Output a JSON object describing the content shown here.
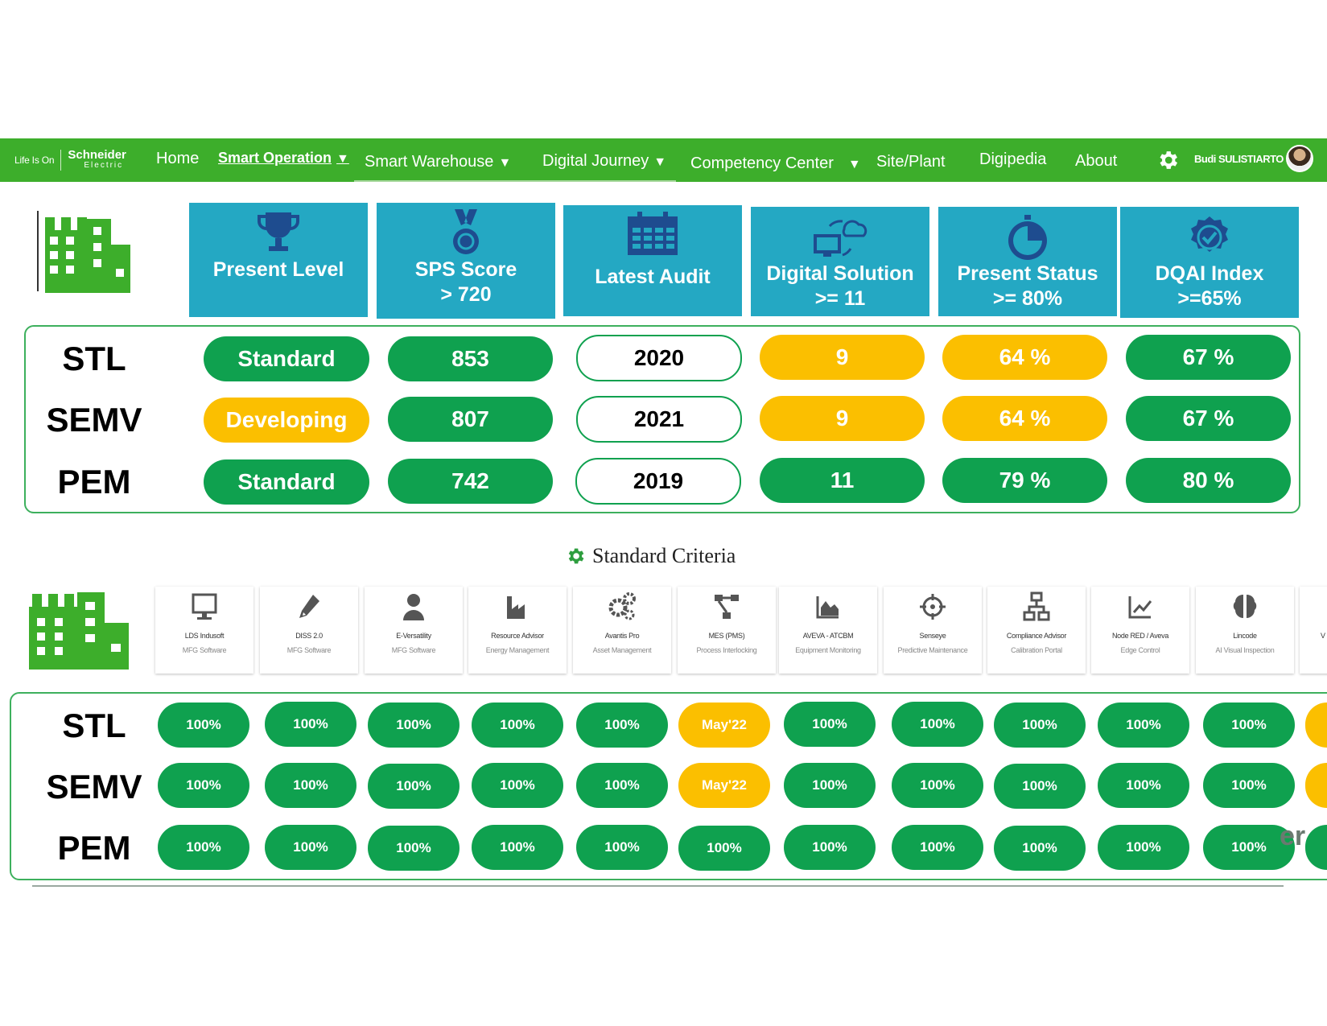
{
  "nav": {
    "tagline": "Life Is On",
    "logo_main": "Schneider",
    "logo_sub": "Electric",
    "items": [
      {
        "label": "Home",
        "active": false,
        "caret": false
      },
      {
        "label": "Smart Operation",
        "active": true,
        "caret": true
      },
      {
        "label": "Smart Warehouse",
        "active": false,
        "caret": true
      },
      {
        "label": "Digital Journey",
        "active": false,
        "caret": true
      },
      {
        "label": "Competency Center",
        "active": false,
        "caret": true
      },
      {
        "label": "Site/Plant",
        "active": false,
        "caret": false
      },
      {
        "label": "Digipedia",
        "active": false,
        "caret": false
      },
      {
        "label": "About",
        "active": false,
        "caret": false
      }
    ],
    "caret_glyph": "▼",
    "settings_icon": "gear-icon",
    "user_name": "Budi SULISTIARTO"
  },
  "colors": {
    "nav_green": "#3dae2b",
    "card_teal": "#24a8c3",
    "icon_navy": "#1e4c8f",
    "status_green": "#0fa14f",
    "status_yellow": "#fbbf00",
    "building_green": "#3dae2b"
  },
  "summary": {
    "headers": [
      {
        "icon": "trophy-icon",
        "line1": "Present Level",
        "line2": ""
      },
      {
        "icon": "medal-icon",
        "line1": "SPS Score",
        "line2": "> 720"
      },
      {
        "icon": "calendar-icon",
        "line1": "Latest Audit",
        "line2": ""
      },
      {
        "icon": "cloud-sync-icon",
        "line1": "Digital Solution",
        "line2": ">= 11"
      },
      {
        "icon": "stopwatch-icon",
        "line1": "Present Status",
        "line2": ">= 80%"
      },
      {
        "icon": "verified-badge-icon",
        "line1": "DQAI Index",
        "line2": ">=65%"
      }
    ],
    "rows": [
      {
        "plant": "STL",
        "cells": [
          {
            "value": "Standard",
            "status": "green"
          },
          {
            "value": "853",
            "status": "green"
          },
          {
            "value": "2020",
            "status": "white"
          },
          {
            "value": "9",
            "status": "yellow"
          },
          {
            "value": "64 %",
            "status": "yellow"
          },
          {
            "value": "67 %",
            "status": "green"
          }
        ]
      },
      {
        "plant": "SEMV",
        "cells": [
          {
            "value": "Developing",
            "status": "yellow"
          },
          {
            "value": "807",
            "status": "green"
          },
          {
            "value": "2021",
            "status": "white"
          },
          {
            "value": "9",
            "status": "yellow"
          },
          {
            "value": "64 %",
            "status": "yellow"
          },
          {
            "value": "67 %",
            "status": "green"
          }
        ]
      },
      {
        "plant": "PEM",
        "cells": [
          {
            "value": "Standard",
            "status": "green"
          },
          {
            "value": "742",
            "status": "green"
          },
          {
            "value": "2019",
            "status": "white"
          },
          {
            "value": "11",
            "status": "green"
          },
          {
            "value": "79 %",
            "status": "green"
          },
          {
            "value": "80 %",
            "status": "green"
          }
        ]
      }
    ]
  },
  "criteria": {
    "title": "Standard Criteria",
    "tiles": [
      {
        "icon": "monitor-icon",
        "name": "LDS Indusoft",
        "sub": "MFG Software"
      },
      {
        "icon": "pen-icon",
        "name": "DISS 2.0",
        "sub": "MFG Software"
      },
      {
        "icon": "user-icon",
        "name": "E-Versatility",
        "sub": "MFG Software"
      },
      {
        "icon": "factory-icon",
        "name": "Resource Advisor",
        "sub": "Energy Management"
      },
      {
        "icon": "gears-icon",
        "name": "Avantis Pro",
        "sub": "Asset Management"
      },
      {
        "icon": "network-icon",
        "name": "MES (PMS)",
        "sub": "Process Interlocking"
      },
      {
        "icon": "area-chart-icon",
        "name": "AVEVA - ATCBM",
        "sub": "Equipment Monitoring"
      },
      {
        "icon": "crosshair-icon",
        "name": "Senseye",
        "sub": "Predictive Maintenance"
      },
      {
        "icon": "sitemap-icon",
        "name": "Compliance Advisor",
        "sub": "Calibration Portal"
      },
      {
        "icon": "line-chart-icon",
        "name": "Node RED / Aveva",
        "sub": "Edge Control"
      },
      {
        "icon": "brain-icon",
        "name": "Lincode",
        "sub": "AI Visual Inspection"
      },
      {
        "icon": "cut-off-icon",
        "name": "V",
        "sub": ""
      }
    ],
    "rows": [
      {
        "plant": "STL",
        "values": [
          "100%",
          "100%",
          "100%",
          "100%",
          "100%",
          "May'22",
          "100%",
          "100%",
          "100%",
          "100%",
          "100%",
          ""
        ],
        "status": [
          "green",
          "green",
          "green",
          "green",
          "green",
          "yellow",
          "green",
          "green",
          "green",
          "green",
          "green",
          "yellow"
        ]
      },
      {
        "plant": "SEMV",
        "values": [
          "100%",
          "100%",
          "100%",
          "100%",
          "100%",
          "May'22",
          "100%",
          "100%",
          "100%",
          "100%",
          "100%",
          ""
        ],
        "status": [
          "green",
          "green",
          "green",
          "green",
          "green",
          "yellow",
          "green",
          "green",
          "green",
          "green",
          "green",
          "yellow"
        ]
      },
      {
        "plant": "PEM",
        "values": [
          "100%",
          "100%",
          "100%",
          "100%",
          "100%",
          "100%",
          "100%",
          "100%",
          "100%",
          "100%",
          "100%",
          ""
        ],
        "status": [
          "green",
          "green",
          "green",
          "green",
          "green",
          "green",
          "green",
          "green",
          "green",
          "green",
          "green",
          "green"
        ]
      }
    ],
    "overlay_text": "er"
  }
}
